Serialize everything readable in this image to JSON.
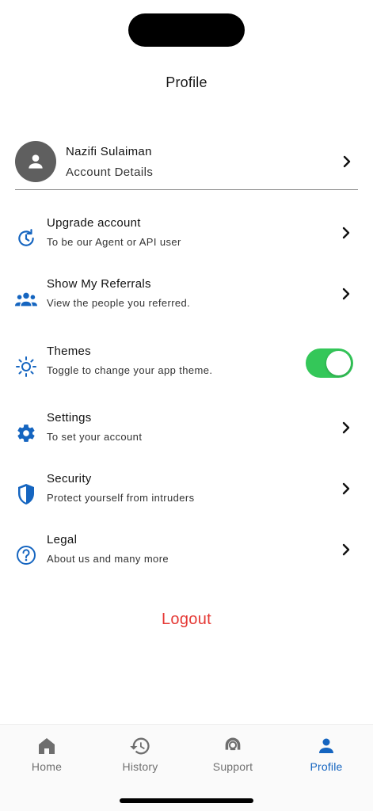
{
  "header": {
    "title": "Profile"
  },
  "account": {
    "name": "Nazifi Sulaiman",
    "subtitle": "Account Details"
  },
  "menu": [
    {
      "label": "Upgrade account",
      "desc": "To be our Agent or API user",
      "icon": "upgrade-icon"
    },
    {
      "label": "Show My Referrals",
      "desc": "View the people you referred.",
      "icon": "people-icon"
    },
    {
      "label": "Themes",
      "desc": "Toggle to change your app theme.",
      "icon": "sun-icon",
      "toggle_on": true
    },
    {
      "label": "Settings",
      "desc": "To set your account",
      "icon": "gear-icon"
    },
    {
      "label": "Security",
      "desc": "Protect yourself from intruders",
      "icon": "shield-icon"
    },
    {
      "label": "Legal",
      "desc": "About us and many more",
      "icon": "help-circle-icon"
    }
  ],
  "logout_label": "Logout",
  "tabs": [
    {
      "label": "Home",
      "icon": "home-icon"
    },
    {
      "label": "History",
      "icon": "history-icon"
    },
    {
      "label": "Support",
      "icon": "support-icon"
    },
    {
      "label": "Profile",
      "icon": "person-icon",
      "active": true
    }
  ],
  "colors": {
    "accent": "#1565c0",
    "logout": "#e53935",
    "toggle_on": "#34c759"
  }
}
